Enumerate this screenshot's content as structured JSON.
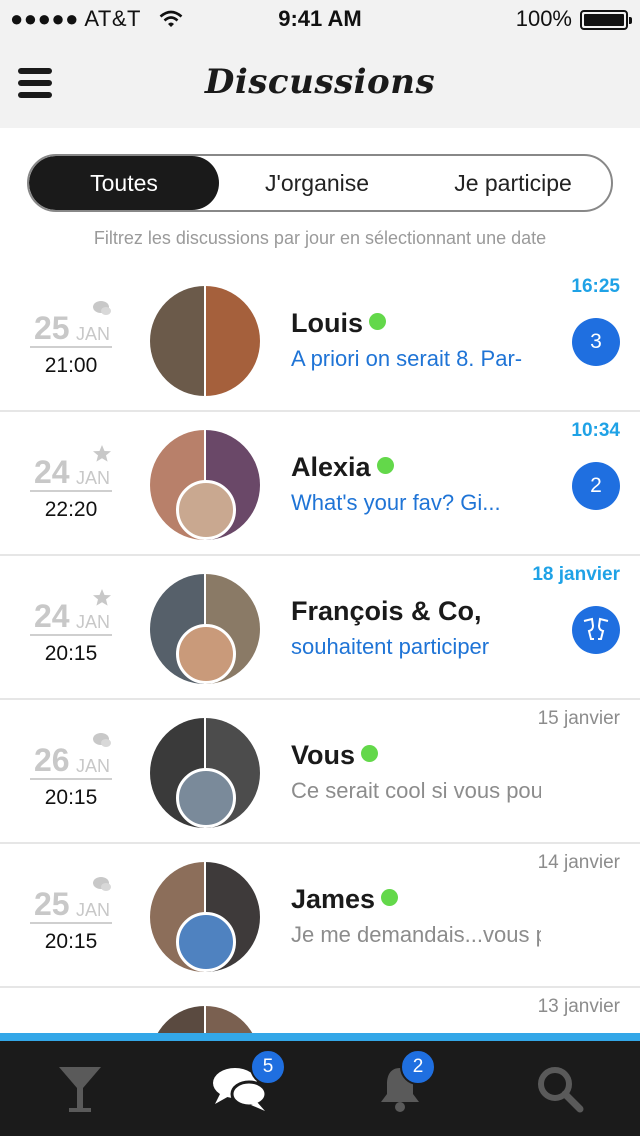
{
  "status_bar": {
    "carrier": "●●●●● AT&T",
    "time": "9:41 AM",
    "battery": "100%"
  },
  "header": {
    "title": "Discussions"
  },
  "filters": {
    "tabs": [
      "Toutes",
      "J'organise",
      "Je participe"
    ],
    "selected": "Toutes",
    "hint": "Filtrez les discussions par jour en sélectionnant une date"
  },
  "discussions": [
    {
      "day": "25",
      "month": "JAN",
      "hour": "21:00",
      "kind_icon": "chat-icon",
      "name": "Louis",
      "online": true,
      "preview": "A priori on serait 8. Par-",
      "stamp": "16:25",
      "unread": true,
      "badge": "3",
      "colors": [
        "#6b5a4a",
        "#a5603c"
      ]
    },
    {
      "day": "24",
      "month": "JAN",
      "hour": "22:20",
      "kind_icon": "star-icon",
      "name": "Alexia",
      "online": true,
      "preview": "What's your fav? Gi...",
      "stamp": "10:34",
      "unread": true,
      "badge": "2",
      "colors": [
        "#b8806a",
        "#6a4868",
        "#c9a890"
      ]
    },
    {
      "day": "24",
      "month": "JAN",
      "hour": "20:15",
      "kind_icon": "star-icon",
      "name": "François & Co,",
      "online": false,
      "preview": "souhaitent participer",
      "stamp": "18 janvier",
      "unread": true,
      "badge_icon": "wine-glasses-icon",
      "colors": [
        "#56606a",
        "#8a7a66",
        "#c99a7a"
      ]
    },
    {
      "day": "26",
      "month": "JAN",
      "hour": "20:15",
      "kind_icon": "chat-icon",
      "name": "Vous",
      "online": true,
      "preview": "Ce serait cool si vous pou...",
      "stamp": "15 janvier",
      "unread": false,
      "colors": [
        "#3a3a3a",
        "#4c4c4c",
        "#7a8a9a"
      ]
    },
    {
      "day": "25",
      "month": "JAN",
      "hour": "20:15",
      "kind_icon": "chat-icon",
      "name": "James",
      "online": true,
      "preview": "Je me demandais...vous pens...",
      "stamp": "14 janvier",
      "unread": false,
      "colors": [
        "#8c6e5a",
        "#3e3a3a",
        "#4f82c0"
      ]
    },
    {
      "day": "",
      "month": "",
      "hour": "",
      "kind_icon": "",
      "name": "",
      "online": false,
      "preview": "",
      "stamp": "13 janvier",
      "unread": false,
      "colors": [
        "#5a4a40",
        "#7a6050"
      ]
    }
  ],
  "tab_bar": {
    "tabs": [
      {
        "name": "cocktail-icon",
        "badge": ""
      },
      {
        "name": "chat-bubbles-icon",
        "badge": "5"
      },
      {
        "name": "bell-icon",
        "badge": "2"
      },
      {
        "name": "search-icon",
        "badge": ""
      }
    ],
    "selected": "chat-bubbles-icon"
  }
}
